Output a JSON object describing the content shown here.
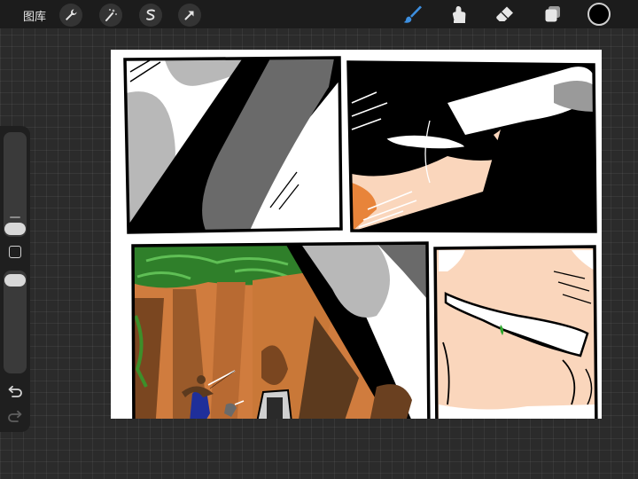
{
  "topbar": {
    "gallery_label": "图库",
    "actions": [
      "wrench-icon",
      "magic-wand-icon",
      "selection-s-icon",
      "transform-arrow-icon"
    ],
    "tools": [
      "brush-icon",
      "smudge-icon",
      "eraser-icon",
      "layers-icon"
    ],
    "active_tool": "brush-icon",
    "active_tool_color": "#3d8fe0",
    "current_color": "#000000"
  },
  "sidebar": {
    "brush_size_level": 0.12,
    "opacity_level": 0.95,
    "icons": [
      "modify-square-icon",
      "undo-icon",
      "redo-icon"
    ]
  },
  "canvas": {
    "content": "manga-comic-page",
    "palette": [
      "#000000",
      "#ffffff",
      "#b5b5b5",
      "#6a6a6a",
      "#fad6bc",
      "#e8843a",
      "#2f7f2a",
      "#d07c3e",
      "#1f2f9a"
    ]
  }
}
